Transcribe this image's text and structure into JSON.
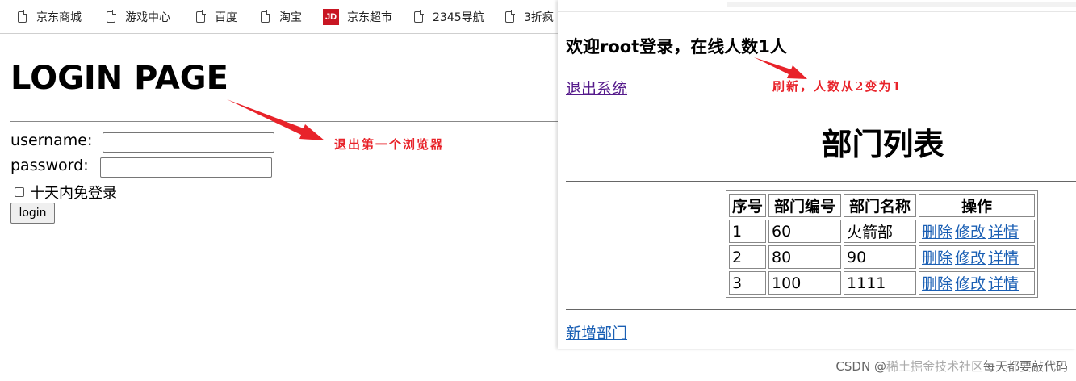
{
  "bookmarks": [
    {
      "label": "京东商城",
      "icon": "page-icon"
    },
    {
      "label": "游戏中心",
      "icon": "page-icon"
    },
    {
      "label": "百度",
      "icon": "page-icon"
    },
    {
      "label": "淘宝",
      "icon": "page-icon"
    },
    {
      "label": "京东超市",
      "icon": "jd-logo-icon",
      "icon_text": "JD"
    },
    {
      "label": "2345导航",
      "icon": "page-icon"
    },
    {
      "label": "3折疯",
      "icon": "page-icon"
    }
  ],
  "login": {
    "title": "LOGIN PAGE",
    "username_label": "username:",
    "username_value": "",
    "password_label": "password:",
    "password_value": "",
    "remember_label": "十天内免登录",
    "remember_checked": false,
    "submit_label": "login"
  },
  "dept": {
    "welcome": "欢迎root登录，在线人数1人",
    "logout": "退出系统",
    "title": "部门列表",
    "columns": [
      "序号",
      "部门编号",
      "部门名称",
      "操作"
    ],
    "rows": [
      {
        "index": "1",
        "no": "60",
        "name": "火箭部",
        "actions": [
          "删除",
          "修改",
          "详情"
        ]
      },
      {
        "index": "2",
        "no": "80",
        "name": "90",
        "actions": [
          "删除",
          "修改",
          "详情"
        ]
      },
      {
        "index": "3",
        "no": "100",
        "name": "1111",
        "actions": [
          "删除",
          "修改",
          "详情"
        ]
      }
    ],
    "add": "新增部门"
  },
  "annotations": {
    "left": "退出第一个浏览器",
    "right": "刷新，人数从2变为1"
  },
  "watermark": {
    "csdn": "CSDN @",
    "text": "稀土掘金技术社区",
    "overlay": "每天都要敲代码"
  },
  "colors": {
    "annotation": "#e8232a",
    "link": "#1a5fb4",
    "visited_link": "#551a8b",
    "jd_brand": "#c81623"
  }
}
